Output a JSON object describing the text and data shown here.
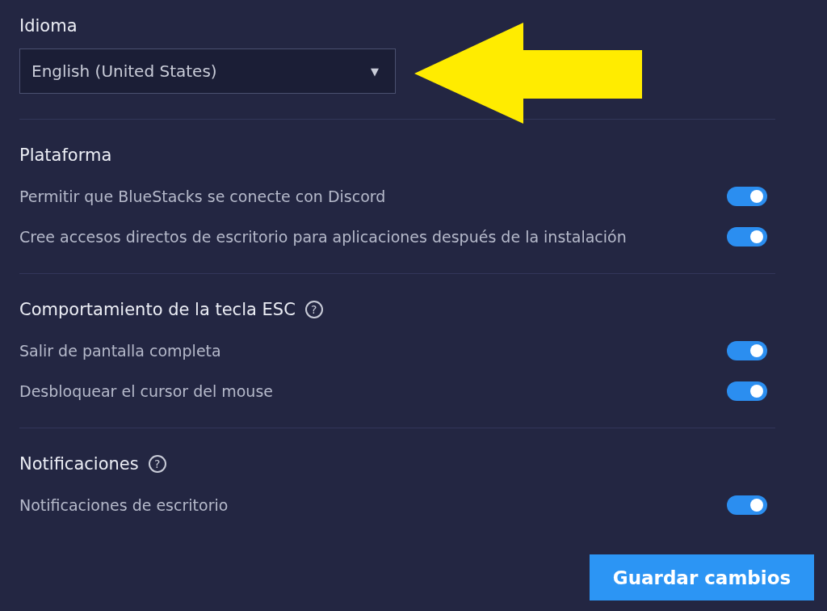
{
  "language": {
    "label": "Idioma",
    "value": "English (United States)",
    "caret": "▼"
  },
  "sections": [
    {
      "title": "Plataforma",
      "options": [
        {
          "label": "Permitir que BlueStacks se conecte con Discord",
          "on": true
        },
        {
          "label": "Cree accesos directos de escritorio para aplicaciones después de la instalación",
          "on": true
        }
      ]
    },
    {
      "title": "Comportamiento de la tecla ESC",
      "help": "?",
      "options": [
        {
          "label": "Salir de pantalla completa",
          "on": true
        },
        {
          "label": "Desbloquear el cursor del mouse",
          "on": true
        }
      ]
    },
    {
      "title": "Notificaciones",
      "help": "?",
      "options": [
        {
          "label": "Notificaciones de escritorio",
          "on": true
        }
      ]
    }
  ],
  "save_button": "Guardar cambios"
}
